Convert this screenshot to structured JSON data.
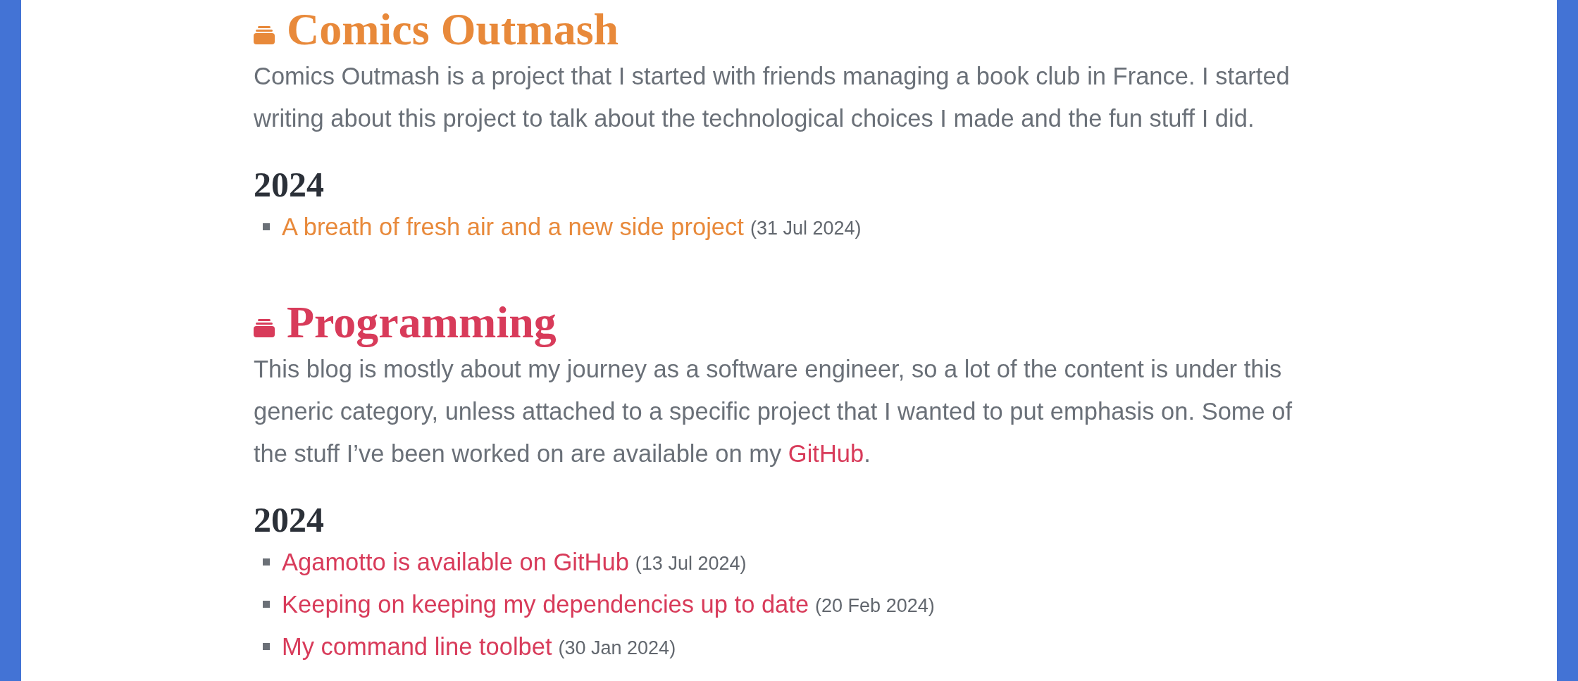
{
  "sections": [
    {
      "title": "Comics Outmash",
      "color": "#e8893a",
      "description": [
        {
          "kind": "text",
          "text": "Comics Outmash is a project that I started with friends managing a book club in France. I started writing about this project to talk about the technological choices I made and the fun stuff I did."
        }
      ],
      "years": [
        {
          "year": "2024",
          "posts": [
            {
              "title": "A breath of fresh air and a new side project",
              "date": "(31 Jul 2024)"
            }
          ]
        }
      ]
    },
    {
      "title": "Programming",
      "color": "#d83b5a",
      "description": [
        {
          "kind": "text",
          "text": "This blog is mostly about my journey as a software engineer, so a lot of the content is under this generic category, unless attached to a specific project that I wanted to put emphasis on. Some of the stuff I’ve been worked on are available on my "
        },
        {
          "kind": "link",
          "text": "GitHub"
        },
        {
          "kind": "text",
          "text": "."
        }
      ],
      "years": [
        {
          "year": "2024",
          "posts": [
            {
              "title": "Agamotto is available on GitHub",
              "date": "(13 Jul 2024)"
            },
            {
              "title": "Keeping on keeping my dependencies up to date",
              "date": "(20 Feb 2024)"
            },
            {
              "title": "My command line toolbet",
              "date": "(30 Jan 2024)"
            }
          ]
        }
      ]
    }
  ]
}
